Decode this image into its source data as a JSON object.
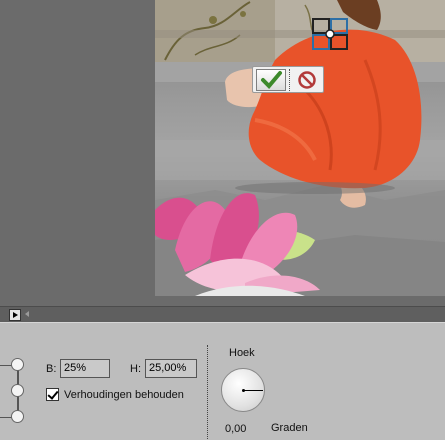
{
  "transform_commit": {
    "commit_icon": "checkmark-icon",
    "cancel_icon": "cancel-circle-icon",
    "commit_color": "#3d8a2c",
    "cancel_color": "#c0392b"
  },
  "options": {
    "width_label": "B:",
    "width_value": "25%",
    "height_label": "H:",
    "height_value": "25,00%",
    "keep_proportions_label": "Verhoudingen behouden",
    "keep_proportions_checked": true,
    "angle_title": "Hoek",
    "angle_value": "0,00",
    "angle_unit": "Graden"
  },
  "colors": {
    "canvas_bg": "#6b6b6b",
    "panel_bg": "#bdbdbd",
    "dress": "#e8532a",
    "lotus": "#d94f8e"
  }
}
